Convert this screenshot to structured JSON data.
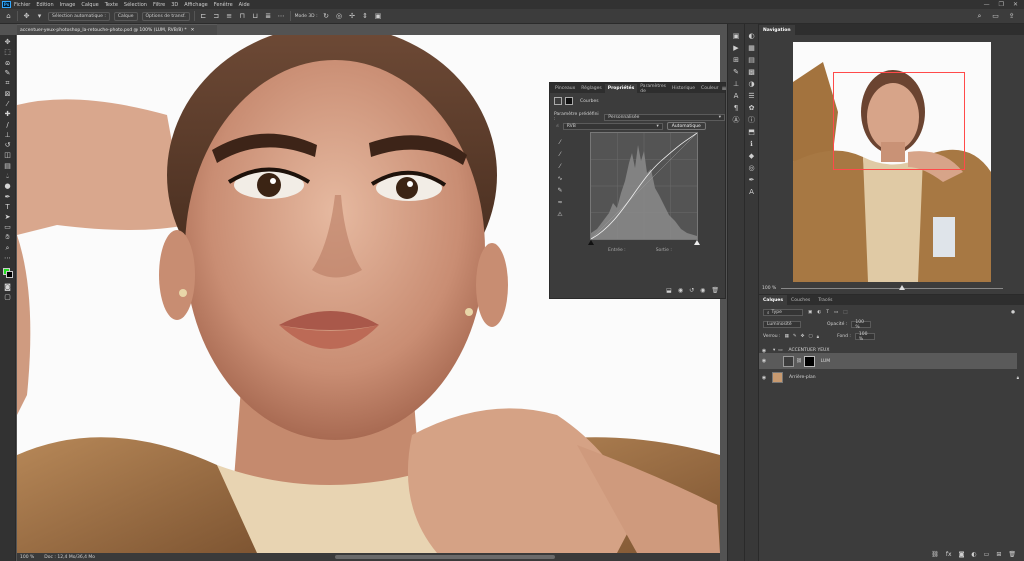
{
  "app": {
    "logo": "Ps"
  },
  "menu": [
    "Fichier",
    "Edition",
    "Image",
    "Calque",
    "Texte",
    "Sélection",
    "Filtre",
    "3D",
    "Affichage",
    "Fenêtre",
    "Aide"
  ],
  "window_controls": [
    "—",
    "❐",
    "✕"
  ],
  "options_bar": {
    "auto_select_label": "Sélection automatique :",
    "auto_select_value": "Calque",
    "transform_label": "Options de transf.",
    "mode_3d_label": "Mode 3D :"
  },
  "document": {
    "tab_title": "accentuer-yeux-photoshop_la-retouche-photo.psd @ 100% (LUM, RVB/8) *",
    "close": "✕",
    "zoom": "100 %",
    "doc_info": "Doc : 12,4 Mo/36,4 Mo"
  },
  "properties": {
    "tabs": [
      "Pinceaux",
      "Réglages",
      "Propriétés",
      "Paramètres de",
      "Historique",
      "Couleur"
    ],
    "active_tab": "Propriétés",
    "adjustment_name": "Courbes",
    "preset_label": "Paramètre prédéfini :",
    "preset_value": "Personnalisée",
    "channel_value": "RVB",
    "auto_button": "Automatique",
    "input_label": "Entrée :",
    "output_label": "Sortie :"
  },
  "navigator": {
    "tab": "Navigation",
    "zoom": "100 %"
  },
  "layers": {
    "tabs": [
      "Calques",
      "Couches",
      "Tracés"
    ],
    "active_tab": "Calques",
    "filter_value": "Type",
    "blend_mode": "Luminosité",
    "opacity_label": "Opacité :",
    "opacity_value": "100 %",
    "lock_label": "Verrou :",
    "fill_label": "Fond :",
    "fill_value": "100 %",
    "items": [
      {
        "name": "ACCENTUER YEUX",
        "kind": "group"
      },
      {
        "name": "LUM",
        "kind": "adjustment",
        "selected": true
      },
      {
        "name": "Arrière-plan",
        "kind": "background"
      }
    ]
  },
  "colors": {
    "foreground": "#23e020",
    "background": "#000000",
    "nav_box": "#ff4a4a"
  }
}
